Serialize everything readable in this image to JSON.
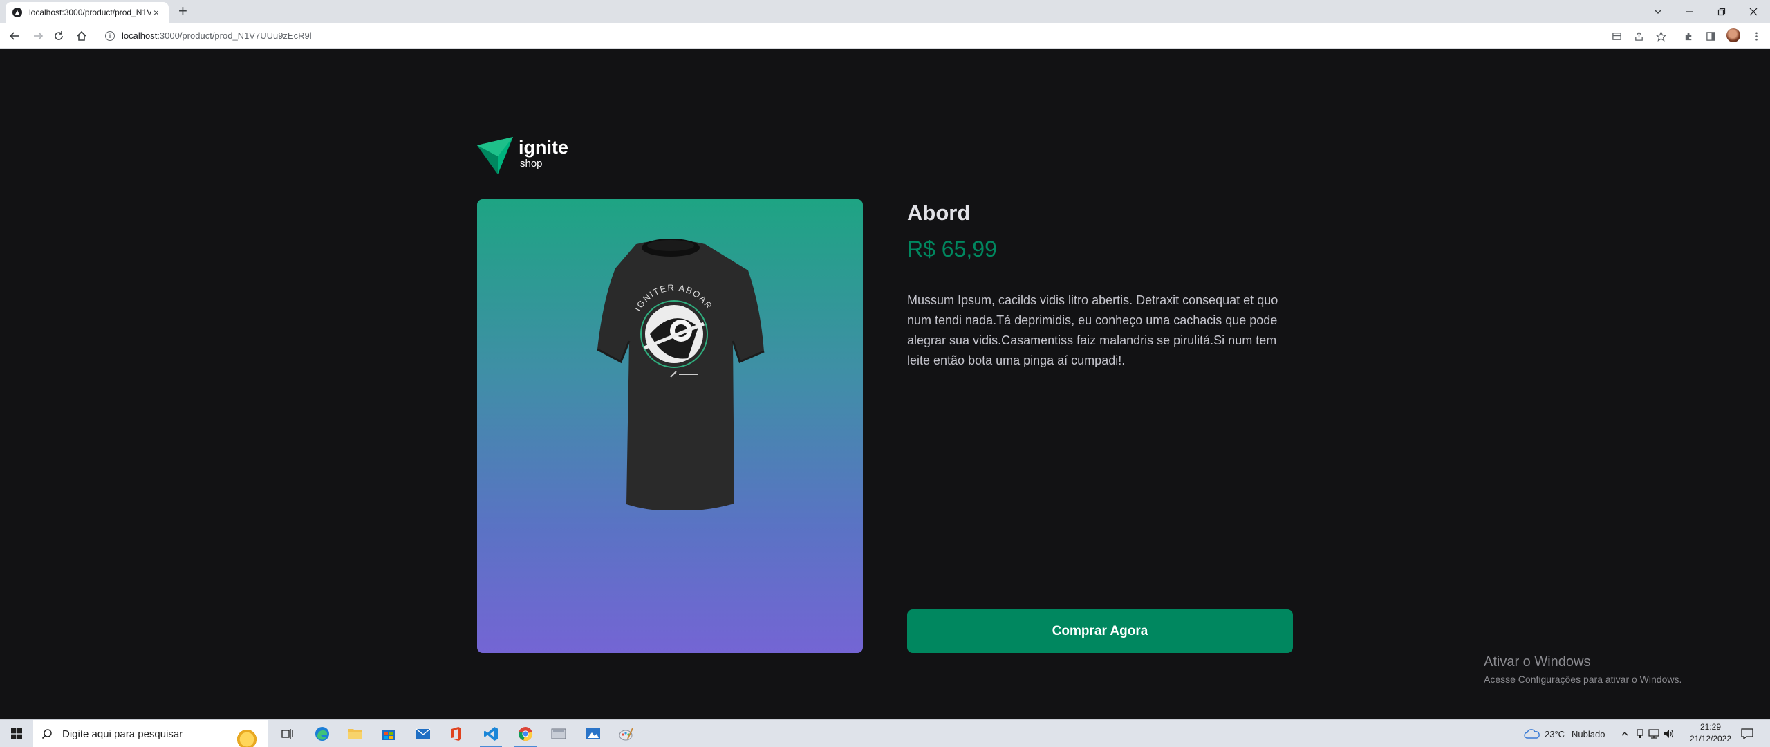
{
  "browser": {
    "tab_title": "localhost:3000/product/prod_N1V7UUu9zEcR9l",
    "tab_close": "×",
    "new_tab": "+",
    "url_host": "localhost",
    "url_path": ":3000/product/prod_N1V7UUu9zEcR9l",
    "info_icon": "i"
  },
  "logo": {
    "word1": "ignite",
    "word2": "shop"
  },
  "product": {
    "title": "Abord",
    "price": "R$ 65,99",
    "description": "Mussum Ipsum, cacilds vidis litro abertis. Detraxit consequat et quo num tendi nada.Tá deprimidis, eu conheço uma cachacis que pode alegrar sua vidis.Casamentiss faiz malandris se pirulitá.Si num tem leite então bota uma pinga aí cumpadi!.",
    "buy_label": "Comprar Agora",
    "shirt_print": "IGNITER ABOARD"
  },
  "watermark": {
    "line1": "Ativar o Windows",
    "line2": "Acesse Configurações para ativar o Windows."
  },
  "taskbar": {
    "search_placeholder": "Digite aqui para pesquisar",
    "weather_temp": "23°C",
    "weather_text": "Nublado",
    "time": "21:29",
    "date": "21/12/2022"
  },
  "colors": {
    "page_bg": "#121214",
    "accent": "#00875f",
    "gradient_top": "#1ea483",
    "gradient_bottom": "#7465d4"
  }
}
